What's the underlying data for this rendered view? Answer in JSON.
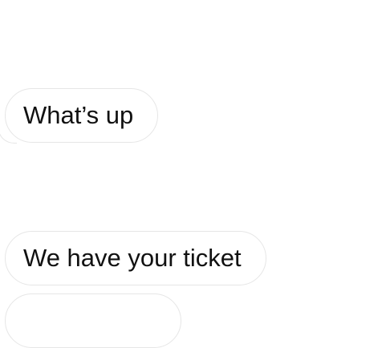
{
  "messages": [
    {
      "text": "What’s up"
    },
    {
      "text": "We have your ticket"
    },
    {
      "text": ""
    }
  ]
}
